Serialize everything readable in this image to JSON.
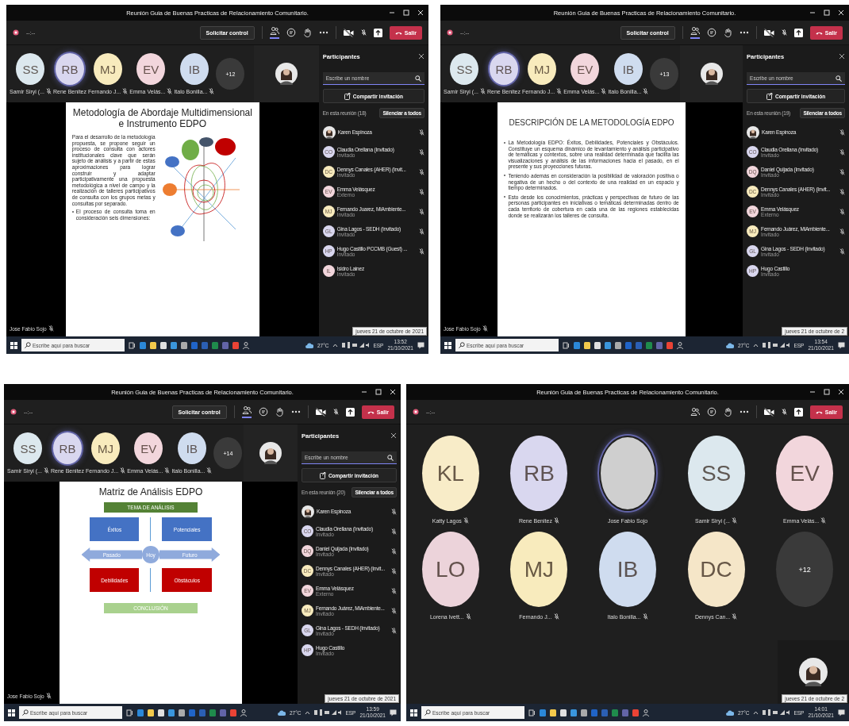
{
  "windows": [
    {
      "title": "Reunión Guia de Buenas Practicas de Relacionamiento Comunitario.",
      "timer": "--:--",
      "request_control": "Solicitar control",
      "leave": "Salir",
      "tiles": [
        {
          "kind": "initials",
          "initials": "SS",
          "name": "Samir Siryi (...",
          "color": "#dce8ee",
          "muted": true,
          "speaking": false
        },
        {
          "kind": "initials",
          "initials": "RB",
          "name": "Rene Benitez",
          "color": "#d9d7ef",
          "muted": false,
          "speaking": true
        },
        {
          "kind": "initials",
          "initials": "MJ",
          "name": "Fernando J...",
          "color": "#f8ebbd",
          "muted": true,
          "speaking": false
        },
        {
          "kind": "initials",
          "initials": "EV",
          "name": "Emma Velás...",
          "color": "#f2d6dc",
          "muted": true,
          "speaking": false
        },
        {
          "kind": "initials",
          "initials": "IB",
          "name": "Italo Bonilla...",
          "color": "#cfdcef",
          "muted": true,
          "speaking": false
        },
        {
          "kind": "overflow",
          "initials": "+12"
        }
      ],
      "presenter": "Jose Fabio Sojo",
      "presenter_muted": true,
      "slide": {
        "kind": "text_diagram",
        "title": "Metodología de Abordaje Multidimensional e Instrumento EDPO",
        "paragraph": "Para el desarrollo de la metodología propuesta, se propone seguir un proceso de consulta con actores institucionales clave que serán sujeto de análisis y a partir de estas aproximaciones para lograr construir y adaptar participativamente una propuesta metodológica a nivel de campo y la realización de talleres participativos de consulta con los grupos metas y consultas por separado.",
        "bullets": [
          "El proceso de consulta toma en consideración seis dimensiones:"
        ]
      },
      "panel": {
        "title": "Participantes",
        "search_placeholder": "Escribe un nombre",
        "invite": "Compartir invitación",
        "section": "En esta reunión (18)",
        "mute_all": "Silenciar a todos",
        "people": [
          {
            "kind": "photo",
            "name": "Karen Espinoza",
            "muted": true
          },
          {
            "kind": "initials",
            "initials": "CO",
            "name": "Claudia Orellana (Invitado)",
            "role": "Invitado",
            "color": "#d9d7ef",
            "muted": true
          },
          {
            "kind": "initials",
            "initials": "DC",
            "name": "Dennys Canales (AHER) (Invit...",
            "role": "Invitado",
            "color": "#f8ebbd",
            "muted": true
          },
          {
            "kind": "initials",
            "initials": "EV",
            "name": "Emma Velásquez",
            "role": "Externo",
            "color": "#f2d6dc",
            "muted": true
          },
          {
            "kind": "initials",
            "initials": "MJ",
            "name": "Fernando Juarez, MiAmbiente...",
            "role": "Invitado",
            "color": "#f8ebbd",
            "muted": true
          },
          {
            "kind": "initials",
            "initials": "GL",
            "name": "Gina Lagos - SEDH (Invitado)",
            "role": "Invitado",
            "color": "#d9d7ef",
            "muted": true
          },
          {
            "kind": "initials",
            "initials": "HP",
            "name": "Hugo Castillo PCCMB (Guest) ...",
            "role": "Invitado",
            "color": "#d9d7ef",
            "muted": true
          },
          {
            "kind": "initials",
            "initials": "IL",
            "name": "Isidro Lainez",
            "role": "Invitado",
            "color": "#f2d6dc",
            "muted": false
          }
        ]
      },
      "taskbar": {
        "search_placeholder": "Escribe aquí para buscar",
        "temperature": "27°C",
        "language": "ESP",
        "time": "13:52",
        "date": "21/10/2021",
        "tooltip": "jueves 21 de octubre de 2021"
      }
    },
    {
      "title": "Reunión Guia de Buenas Practicas de Relacionamiento Comunitario.",
      "timer": "--:--",
      "request_control": "Solicitar control",
      "leave": "Salir",
      "tiles": [
        {
          "kind": "initials",
          "initials": "SS",
          "name": "Samir Siryi (...",
          "color": "#dce8ee",
          "muted": true,
          "speaking": false
        },
        {
          "kind": "initials",
          "initials": "RB",
          "name": "Rene Benitez",
          "color": "#d9d7ef",
          "muted": false,
          "speaking": true
        },
        {
          "kind": "initials",
          "initials": "MJ",
          "name": "Fernando J...",
          "color": "#f8ebbd",
          "muted": true,
          "speaking": false
        },
        {
          "kind": "initials",
          "initials": "EV",
          "name": "Emma Velás...",
          "color": "#f2d6dc",
          "muted": true,
          "speaking": false
        },
        {
          "kind": "initials",
          "initials": "IB",
          "name": "Italo Bonilla...",
          "color": "#cfdcef",
          "muted": true,
          "speaking": false
        },
        {
          "kind": "overflow",
          "initials": "+13"
        }
      ],
      "presenter": "Jose Fabio Sojo",
      "presenter_muted": true,
      "slide": {
        "kind": "bullets",
        "title": "DESCRIPCIÓN DE LA METODOLOGÍA EDPO",
        "bullets": [
          "La Metodología EDPO: Éxitos, Debilidades, Potenciales y Obstáculos. Constituye un esquema dinámico de levantamiento y análisis participativo de temáticas y contextos, sobre una realidad determinada que facilita las visualizaciones y análisis de las informaciones hacia el pasado, en el presente y sus proyecciones futuras.",
          "Teniendo además en consideración la posibilidad de valoración positiva o negativa de un hecho o del contexto de una realidad en un espacio y tiempo determinados.",
          "Esto desde los conocimientos, prácticas y perspectivas de futuro de las personas participantes en iniciativas o temáticas determinadas dentro de cada territorio de cobertura en cada una de las regiones establecidas donde se realizarán los talleres de consulta."
        ]
      },
      "panel": {
        "title": "Participantes",
        "search_placeholder": "Escribe un nombre",
        "invite": "Compartir invitación",
        "section": "En esta reunión (19)",
        "mute_all": "Silenciar a todos",
        "people": [
          {
            "kind": "photo",
            "name": "Karen Espinoza",
            "muted": true
          },
          {
            "kind": "initials",
            "initials": "CO",
            "name": "Claudia Orellana (Invitado)",
            "role": "Invitado",
            "color": "#d9d7ef",
            "muted": true
          },
          {
            "kind": "initials",
            "initials": "DQ",
            "name": "Daniel Quijada (Invitado)",
            "role": "Invitado",
            "color": "#f2d6dc",
            "muted": true
          },
          {
            "kind": "initials",
            "initials": "DC",
            "name": "Dennys Canales (AHER) (Invit...",
            "role": "Invitado",
            "color": "#f8ebbd",
            "muted": true
          },
          {
            "kind": "initials",
            "initials": "EV",
            "name": "Emma Velásquez",
            "role": "Externo",
            "color": "#f2d6dc",
            "muted": true
          },
          {
            "kind": "initials",
            "initials": "MJ",
            "name": "Fernando Juárez, MiAmbiente...",
            "role": "Invitado",
            "color": "#f8ebbd",
            "muted": true
          },
          {
            "kind": "initials",
            "initials": "GL",
            "name": "Gina Lagos - SEDH (Invitado)",
            "role": "Invitado",
            "color": "#d9d7ef",
            "muted": true
          },
          {
            "kind": "initials",
            "initials": "HP",
            "name": "Hugo Castillo",
            "role": "Invitado",
            "color": "#d9d7ef",
            "muted": false
          }
        ]
      },
      "taskbar": {
        "search_placeholder": "Escribe aquí para buscar",
        "temperature": "27°C",
        "language": "ESP",
        "time": "13:54",
        "date": "21/10/2021",
        "tooltip": "jueves 21 de octubre de 2"
      }
    },
    {
      "title": "Reunión Guia de Buenas Practicas de Relacionamiento Comunitario.",
      "timer": "--:--",
      "request_control": "Solicitar control",
      "leave": "Salir",
      "tiles": [
        {
          "kind": "initials",
          "initials": "SS",
          "name": "Samir Siryi (...",
          "color": "#dce8ee",
          "muted": true,
          "speaking": false
        },
        {
          "kind": "initials",
          "initials": "RB",
          "name": "Rene Benitez",
          "color": "#d9d7ef",
          "muted": false,
          "speaking": true
        },
        {
          "kind": "initials",
          "initials": "MJ",
          "name": "Fernando J...",
          "color": "#f8ebbd",
          "muted": true,
          "speaking": false
        },
        {
          "kind": "initials",
          "initials": "EV",
          "name": "Emma Velás...",
          "color": "#f2d6dc",
          "muted": true,
          "speaking": false
        },
        {
          "kind": "initials",
          "initials": "IB",
          "name": "Italo Bonilla...",
          "color": "#cfdcef",
          "muted": true,
          "speaking": false
        },
        {
          "kind": "overflow",
          "initials": "+14"
        }
      ],
      "presenter": "Jose Fabio Sojo",
      "presenter_muted": true,
      "slide": {
        "kind": "matrix",
        "title": "Matriz de Análisis EDPO",
        "top": "TEMA DE ANÁLISIS",
        "bottom": "CONCLUSIÓN",
        "past": "Pasado",
        "today": "Hoy",
        "future": "Futuro",
        "quadrants": [
          {
            "label": "Éxitos",
            "color": "#4472c4"
          },
          {
            "label": "Potenciales",
            "color": "#4472c4"
          },
          {
            "label": "Debilidades",
            "color": "#c00000"
          },
          {
            "label": "Obstáculos",
            "color": "#c00000"
          }
        ]
      },
      "panel": {
        "title": "Participantes",
        "search_placeholder": "Escribe un nombre",
        "invite": "Compartir invitación",
        "section": "En esta reunión (20)",
        "mute_all": "Silenciar a todos",
        "people": [
          {
            "kind": "photo",
            "name": "Karen Espinoza",
            "muted": true
          },
          {
            "kind": "initials",
            "initials": "CO",
            "name": "Claudia Orellana (Invitado)",
            "role": "Invitado",
            "color": "#d9d7ef",
            "muted": true
          },
          {
            "kind": "initials",
            "initials": "DQ",
            "name": "Daniel Quijada (Invitado)",
            "role": "Invitado",
            "color": "#f2d6dc",
            "muted": true
          },
          {
            "kind": "initials",
            "initials": "DC",
            "name": "Dennys Canales (AHER) (Invit...",
            "role": "Invitado",
            "color": "#f8ebbd",
            "muted": true
          },
          {
            "kind": "initials",
            "initials": "EV",
            "name": "Emma Velásquez",
            "role": "Externo",
            "color": "#f2d6dc",
            "muted": true
          },
          {
            "kind": "initials",
            "initials": "MJ",
            "name": "Fernando Juárez, MiAmbiente...",
            "role": "Invitado",
            "color": "#f8ebbd",
            "muted": true
          },
          {
            "kind": "initials",
            "initials": "GL",
            "name": "Gina Lagos - SEDH (Invitado)",
            "role": "Invitado",
            "color": "#d9d7ef",
            "muted": true
          },
          {
            "kind": "initials",
            "initials": "HP",
            "name": "Hugo Castillo",
            "role": "Invitado",
            "color": "#d9d7ef",
            "muted": false
          }
        ]
      },
      "taskbar": {
        "search_placeholder": "Escribe aquí para buscar",
        "temperature": "27°C",
        "language": "ESP",
        "time": "13:59",
        "date": "21/10/2021",
        "tooltip": "jueves 21 de octubre de 2021"
      }
    },
    {
      "title": "Reunión Guia de Buenas Practicas de Relacionamiento Comunitario.",
      "timer": "--:--",
      "leave": "Salir",
      "tiles": [
        {
          "kind": "initials",
          "initials": "KL",
          "name": "Katty Lagos",
          "color": "#f8ecc8",
          "muted": true,
          "speaking": false
        },
        {
          "kind": "initials",
          "initials": "RB",
          "name": "Rene Benitez",
          "color": "#d9d7ef",
          "muted": true,
          "speaking": false
        },
        {
          "kind": "photo",
          "name": "Jose Fabio Sojo",
          "muted": false,
          "speaking": true
        },
        {
          "kind": "initials",
          "initials": "SS",
          "name": "Samir Siryi (...",
          "color": "#dce8ee",
          "muted": true,
          "speaking": false
        },
        {
          "kind": "initials",
          "initials": "EV",
          "name": "Emma Velás...",
          "color": "#f2d6dc",
          "muted": true,
          "speaking": false
        },
        {
          "kind": "initials",
          "initials": "LO",
          "name": "Lorena Ivett...",
          "color": "#ecd3da",
          "muted": true,
          "speaking": false
        },
        {
          "kind": "initials",
          "initials": "MJ",
          "name": "Fernando J...",
          "color": "#f8ebbd",
          "muted": true,
          "speaking": false
        },
        {
          "kind": "initials",
          "initials": "IB",
          "name": "Italo Bonilla...",
          "color": "#cfdcef",
          "muted": true,
          "speaking": false
        },
        {
          "kind": "initials",
          "initials": "DC",
          "name": "Dennys Can...",
          "color": "#f5e6c8",
          "muted": true,
          "speaking": false
        },
        {
          "kind": "overflow",
          "initials": "+12"
        }
      ],
      "taskbar": {
        "search_placeholder": "Escribe aquí para buscar",
        "temperature": "27°C",
        "language": "ESP",
        "time": "14:01",
        "date": "21/10/2021",
        "tooltip": "jueves 21 de octubre de 2"
      }
    }
  ]
}
